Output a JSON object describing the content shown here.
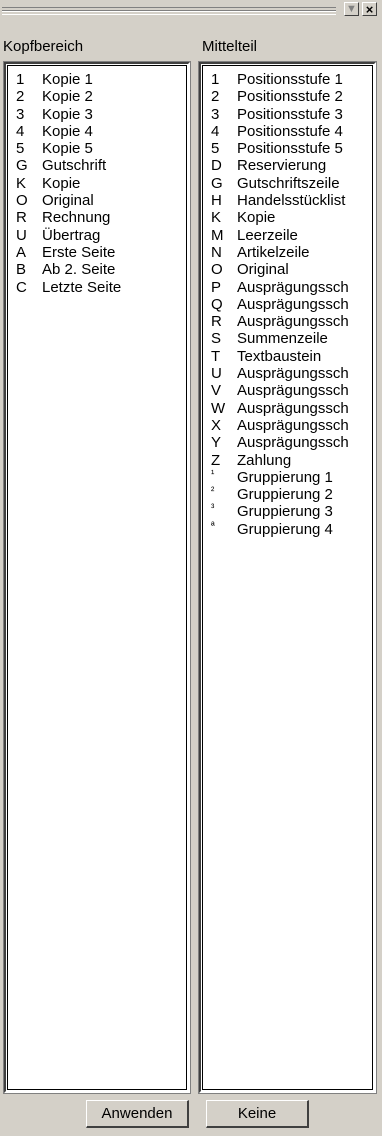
{
  "toolbar": {
    "dropdown_icon": "chevron-down-icon",
    "close_glyph": "×"
  },
  "left": {
    "header": "Kopfbereich",
    "items": [
      {
        "key": "1",
        "label": "Kopie 1"
      },
      {
        "key": "2",
        "label": "Kopie 2"
      },
      {
        "key": "3",
        "label": "Kopie 3"
      },
      {
        "key": "4",
        "label": "Kopie 4"
      },
      {
        "key": "5",
        "label": "Kopie 5"
      },
      {
        "key": "G",
        "label": "Gutschrift"
      },
      {
        "key": "K",
        "label": "Kopie"
      },
      {
        "key": "O",
        "label": "Original"
      },
      {
        "key": "R",
        "label": "Rechnung"
      },
      {
        "key": "U",
        "label": "Übertrag"
      },
      {
        "key": "A",
        "label": "Erste Seite"
      },
      {
        "key": "B",
        "label": "Ab 2. Seite"
      },
      {
        "key": "C",
        "label": "Letzte Seite"
      }
    ]
  },
  "right": {
    "header": "Mittelteil",
    "items": [
      {
        "key": "1",
        "label": "Positionsstufe 1"
      },
      {
        "key": "2",
        "label": "Positionsstufe 2"
      },
      {
        "key": "3",
        "label": "Positionsstufe 3"
      },
      {
        "key": "4",
        "label": "Positionsstufe 4"
      },
      {
        "key": "5",
        "label": "Positionsstufe 5"
      },
      {
        "key": "D",
        "label": "Reservierung"
      },
      {
        "key": "G",
        "label": "Gutschriftszeile"
      },
      {
        "key": "H",
        "label": "Handelsstücklist"
      },
      {
        "key": "K",
        "label": "Kopie"
      },
      {
        "key": "M",
        "label": "Leerzeile"
      },
      {
        "key": "N",
        "label": "Artikelzeile"
      },
      {
        "key": "O",
        "label": "Original"
      },
      {
        "key": "P",
        "label": "Ausprägungssch"
      },
      {
        "key": "Q",
        "label": "Ausprägungssch"
      },
      {
        "key": "R",
        "label": "Ausprägungssch"
      },
      {
        "key": "S",
        "label": "Summenzeile"
      },
      {
        "key": "T",
        "label": "Textbaustein"
      },
      {
        "key": "U",
        "label": "Ausprägungssch"
      },
      {
        "key": "V",
        "label": "Ausprägungssch"
      },
      {
        "key": "W",
        "label": "Ausprägungssch"
      },
      {
        "key": "X",
        "label": "Ausprägungssch"
      },
      {
        "key": "Y",
        "label": "Ausprägungssch"
      },
      {
        "key": "Z",
        "label": "Zahlung"
      },
      {
        "key": "¹",
        "label": "Gruppierung 1",
        "sup": true
      },
      {
        "key": "²",
        "label": "Gruppierung 2",
        "sup": true
      },
      {
        "key": "³",
        "label": "Gruppierung 3",
        "sup": true
      },
      {
        "key": "ª",
        "label": "Gruppierung 4",
        "sup": true
      }
    ]
  },
  "buttons": {
    "apply": "Anwenden",
    "none": "Keine"
  }
}
